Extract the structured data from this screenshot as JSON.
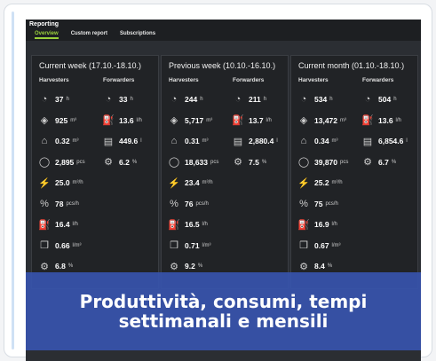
{
  "app": {
    "title": "Reporting",
    "tabs": [
      "Overview",
      "Custom report",
      "Subscriptions"
    ]
  },
  "labels": {
    "harvesters": "Harvesters",
    "forwarders": "Forwarders"
  },
  "panels": [
    {
      "title": "Current week (17.10.-18.10.)",
      "harvesters": [
        {
          "icon": "engine-hours-icon",
          "value": "37",
          "unit": "h"
        },
        {
          "icon": "volume-icon",
          "value": "925",
          "unit": "m³"
        },
        {
          "icon": "avg-stem-icon",
          "value": "0.32",
          "unit": "m³"
        },
        {
          "icon": "stem-count-icon",
          "value": "2,895",
          "unit": "pcs"
        },
        {
          "icon": "productivity-m3-icon",
          "value": "25.0",
          "unit": "m³/h"
        },
        {
          "icon": "productivity-pcs-icon",
          "value": "78",
          "unit": "pcs/h"
        },
        {
          "icon": "fuel-icon",
          "value": "16.4",
          "unit": "l/h"
        },
        {
          "icon": "fuel-per-m3-icon",
          "value": "0.66",
          "unit": "l/m³"
        },
        {
          "icon": "utilization-icon",
          "value": "6.8",
          "unit": "%"
        }
      ],
      "forwarders": [
        {
          "icon": "engine-hours-icon",
          "value": "33",
          "unit": "h"
        },
        {
          "icon": "fuel-icon",
          "value": "13.6",
          "unit": "l/h"
        },
        {
          "icon": "fuel-total-icon",
          "value": "449.6",
          "unit": "l"
        },
        {
          "icon": "utilization-icon",
          "value": "6.2",
          "unit": "%"
        }
      ]
    },
    {
      "title": "Previous week (10.10.-16.10.)",
      "harvesters": [
        {
          "icon": "engine-hours-icon",
          "value": "244",
          "unit": "h"
        },
        {
          "icon": "volume-icon",
          "value": "5,717",
          "unit": "m³"
        },
        {
          "icon": "avg-stem-icon",
          "value": "0.31",
          "unit": "m³"
        },
        {
          "icon": "stem-count-icon",
          "value": "18,633",
          "unit": "pcs"
        },
        {
          "icon": "productivity-m3-icon",
          "value": "23.4",
          "unit": "m³/h"
        },
        {
          "icon": "productivity-pcs-icon",
          "value": "76",
          "unit": "pcs/h"
        },
        {
          "icon": "fuel-icon",
          "value": "16.5",
          "unit": "l/h"
        },
        {
          "icon": "fuel-per-m3-icon",
          "value": "0.71",
          "unit": "l/m³"
        },
        {
          "icon": "utilization-icon",
          "value": "9.2",
          "unit": "%"
        }
      ],
      "forwarders": [
        {
          "icon": "engine-hours-icon",
          "value": "211",
          "unit": "h"
        },
        {
          "icon": "fuel-icon",
          "value": "13.7",
          "unit": "l/h"
        },
        {
          "icon": "fuel-total-icon",
          "value": "2,880.4",
          "unit": "l"
        },
        {
          "icon": "utilization-icon",
          "value": "7.5",
          "unit": "%"
        }
      ]
    },
    {
      "title": "Current month (01.10.-18.10.)",
      "harvesters": [
        {
          "icon": "engine-hours-icon",
          "value": "534",
          "unit": "h"
        },
        {
          "icon": "volume-icon",
          "value": "13,472",
          "unit": "m³"
        },
        {
          "icon": "avg-stem-icon",
          "value": "0.34",
          "unit": "m³"
        },
        {
          "icon": "stem-count-icon",
          "value": "39,870",
          "unit": "pcs"
        },
        {
          "icon": "productivity-m3-icon",
          "value": "25.2",
          "unit": "m³/h"
        },
        {
          "icon": "productivity-pcs-icon",
          "value": "75",
          "unit": "pcs/h"
        },
        {
          "icon": "fuel-icon",
          "value": "16.9",
          "unit": "l/h"
        },
        {
          "icon": "fuel-per-m3-icon",
          "value": "0.67",
          "unit": "l/m³"
        },
        {
          "icon": "utilization-icon",
          "value": "8.4",
          "unit": "%"
        }
      ],
      "forwarders": [
        {
          "icon": "engine-hours-icon",
          "value": "504",
          "unit": "h"
        },
        {
          "icon": "fuel-icon",
          "value": "13.6",
          "unit": "l/h"
        },
        {
          "icon": "fuel-total-icon",
          "value": "6,854.6",
          "unit": "l"
        },
        {
          "icon": "utilization-icon",
          "value": "6.7",
          "unit": "%"
        }
      ]
    }
  ],
  "banner": {
    "line1": "Produttività, consumi, tempi",
    "line2": "settimanali e mensili"
  },
  "colors": {
    "accent_tab": "#9bd13b",
    "banner": "#3754ac",
    "panel_bg": "#212326"
  }
}
